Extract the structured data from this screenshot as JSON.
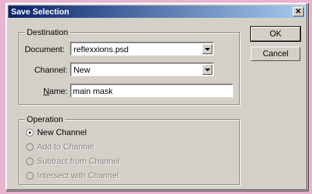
{
  "window": {
    "title": "Save Selection",
    "close_glyph": "✕"
  },
  "buttons": {
    "ok": "OK",
    "cancel": "Cancel"
  },
  "destination": {
    "legend": "Destination",
    "document_label": "Document:",
    "document_value": "reflexxions.psd",
    "channel_label": "Channel:",
    "channel_value": "New",
    "name_label": "Name:",
    "name_value": "main mask"
  },
  "operation": {
    "legend": "Operation",
    "options": [
      {
        "label": "New Channel",
        "selected": true,
        "enabled": true
      },
      {
        "label": "Add to Channel",
        "selected": false,
        "enabled": false
      },
      {
        "label": "Subtract from Channel",
        "selected": false,
        "enabled": false
      },
      {
        "label": "Intersect with Channel",
        "selected": false,
        "enabled": false
      }
    ]
  }
}
